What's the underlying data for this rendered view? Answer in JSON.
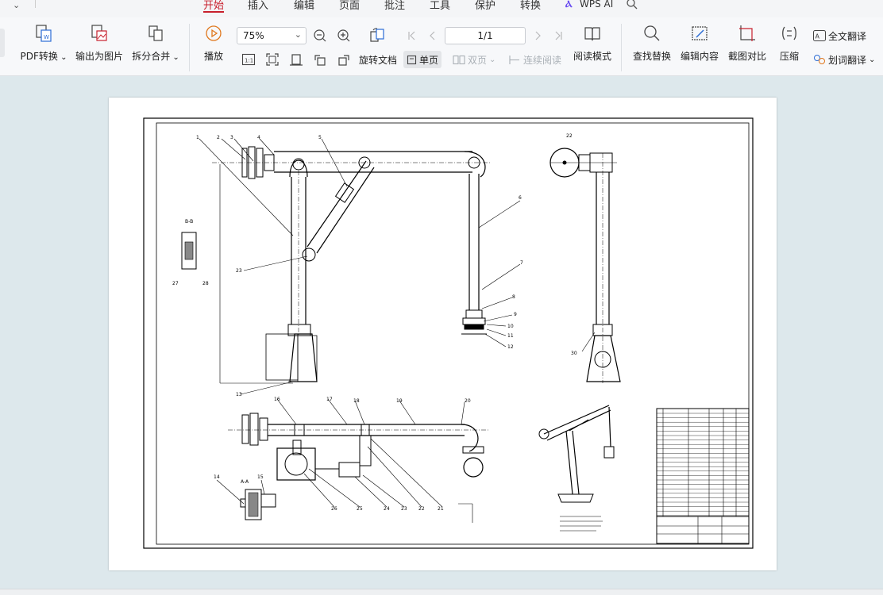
{
  "menu": {
    "tabs": [
      "开始",
      "插入",
      "编辑",
      "页面",
      "批注",
      "工具",
      "保护",
      "转换"
    ],
    "active_tab": "开始",
    "wps_ai": "WPS AI",
    "accent": "#c8202d"
  },
  "ribbon": {
    "pdf_convert": "PDF转换",
    "export_image": "输出为图片",
    "split_merge": "拆分合并",
    "play": "播放",
    "zoom_value": "75%",
    "actual_size_glyph": "1:1",
    "rotate_doc": "旋转文档",
    "single_page": "单页",
    "double_page": "双页",
    "continuous": "连续阅读",
    "page_indicator": "1/1",
    "read_mode": "阅读模式",
    "find_replace": "查找替换",
    "edit_content": "编辑内容",
    "screenshot_compare": "截图对比",
    "compress": "压缩",
    "full_translate": "全文翻译",
    "word_translate": "划词翻译"
  },
  "drawing": {
    "callouts_top": [
      "1",
      "2",
      "3",
      "4",
      "5",
      "6",
      "7",
      "8",
      "9",
      "10",
      "11",
      "12",
      "13",
      "22",
      "23",
      "27",
      "28",
      "30"
    ],
    "callouts_bottom": [
      "14",
      "15",
      "16",
      "17",
      "18",
      "19",
      "20",
      "21",
      "22",
      "23",
      "24",
      "25",
      "26"
    ],
    "section_label": "B-B",
    "section_label_2": "A-A"
  }
}
